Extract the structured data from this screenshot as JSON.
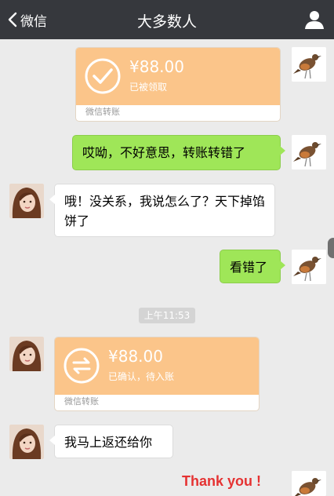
{
  "navbar": {
    "back_label": "微信",
    "title": "大多数人"
  },
  "messages": {
    "transfer_sent": {
      "amount": "¥88.00",
      "status": "已被领取",
      "footer": "微信转账"
    },
    "sent_1": "哎呦，不好意思，转账转错了",
    "recv_1": "哦！没关系，我说怎么了？天下掉馅饼了",
    "sent_2": "看错了",
    "time": "上午11:53",
    "transfer_recv": {
      "amount": "¥88.00",
      "status": "已确认，待入账",
      "footer": "微信转账"
    },
    "recv_2": "我马上返还给你",
    "overlay": "Thank you !"
  },
  "colors": {
    "navbar": "#36383d",
    "green_bubble": "#9fe658",
    "transfer_orange": "#fbc58a",
    "background": "#ebebeb"
  }
}
